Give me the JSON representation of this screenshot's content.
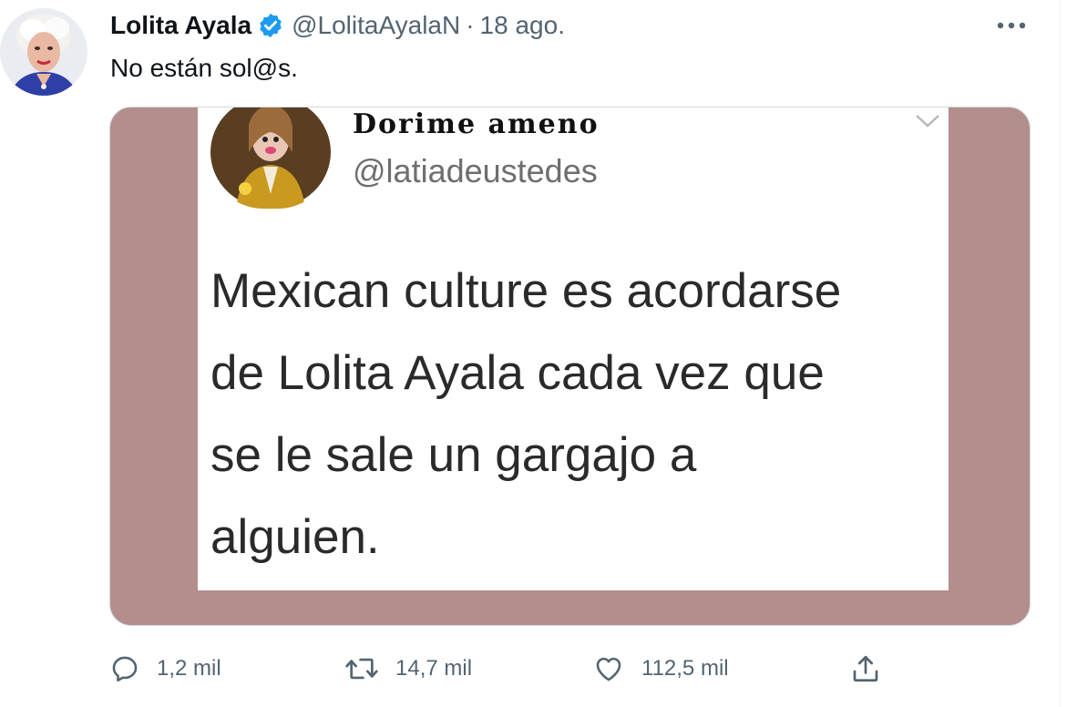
{
  "tweet": {
    "author": {
      "display_name": "Lolita Ayala",
      "handle": "@LolitaAyalaN",
      "verified": true,
      "avatar_icon": "profile-photo"
    },
    "separator": "·",
    "timestamp": "18 ago.",
    "text": "No están sol@s.",
    "more_icon": "ellipsis-icon"
  },
  "embedded_image": {
    "background_color": "#b48e8c",
    "card": {
      "name": "Dorime ameno",
      "handle": "@latiadeustedes",
      "body_lines": [
        "Mexican culture es acordarse",
        "de Lolita Ayala cada vez que",
        "se le sale un gargajo a",
        "alguien."
      ]
    }
  },
  "actions": {
    "reply": {
      "icon": "reply-icon",
      "count": "1,2 mil"
    },
    "retweet": {
      "icon": "retweet-icon",
      "count": "14,7 mil"
    },
    "like": {
      "icon": "heart-icon",
      "count": "112,5 mil"
    },
    "share": {
      "icon": "share-icon"
    }
  },
  "colors": {
    "text_primary": "#0f1419",
    "text_secondary": "#536471",
    "verified_blue": "#1d9bf0"
  }
}
